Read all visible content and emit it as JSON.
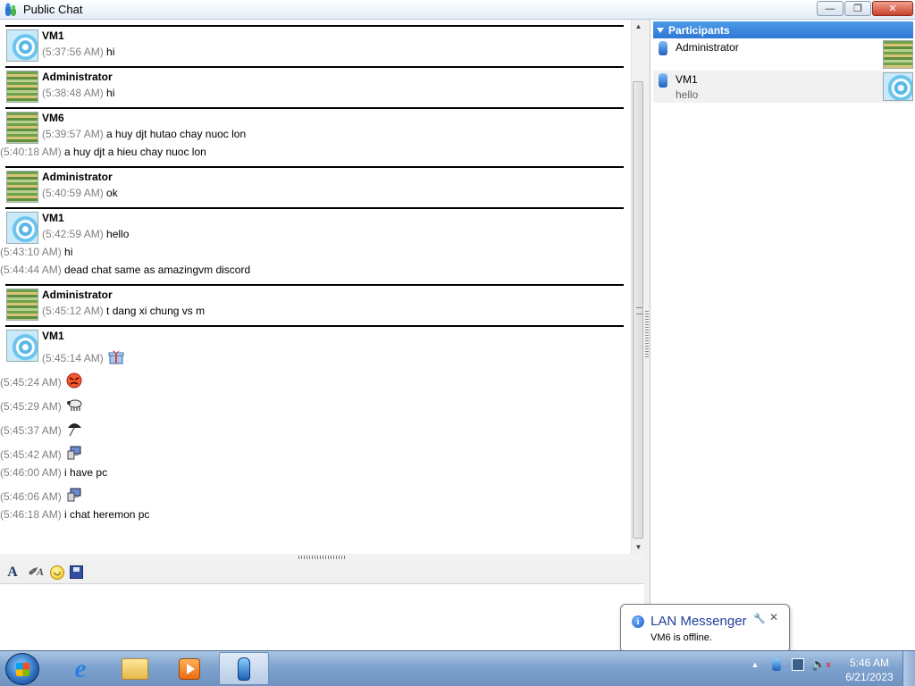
{
  "window": {
    "title": "Public Chat",
    "app_icon": "lan-messenger-icon",
    "buttons": [
      "minimize",
      "maximize",
      "close"
    ]
  },
  "messages": [
    {
      "sender": "VM1",
      "avatar": "vm",
      "lines": [
        {
          "time": "(5:37:56 AM)",
          "text": "hi"
        }
      ]
    },
    {
      "sender": "Administrator",
      "avatar": "admin",
      "lines": [
        {
          "time": "(5:38:48 AM)",
          "text": "hi"
        }
      ]
    },
    {
      "sender": "VM6",
      "avatar": "admin",
      "lines": [
        {
          "time": "(5:39:57 AM)",
          "text": "a huy djt hutao chay nuoc lon"
        },
        {
          "time": "(5:40:18 AM)",
          "text": "a huy djt a hieu chay nuoc lon"
        }
      ]
    },
    {
      "sender": "Administrator",
      "avatar": "admin",
      "lines": [
        {
          "time": "(5:40:59 AM)",
          "text": "ok"
        }
      ]
    },
    {
      "sender": "VM1",
      "avatar": "vm",
      "lines": [
        {
          "time": "(5:42:59 AM)",
          "text": "hello"
        },
        {
          "time": "(5:43:10 AM)",
          "text": "hi"
        },
        {
          "time": "(5:44:44 AM)",
          "text": "dead chat same as amazingvm discord"
        }
      ]
    },
    {
      "sender": "Administrator",
      "avatar": "admin",
      "lines": [
        {
          "time": "(5:45:12 AM)",
          "text": "t dang xi chung vs m"
        }
      ]
    },
    {
      "sender": "VM1",
      "avatar": "vm",
      "lines": [
        {
          "time": "(5:45:14 AM)",
          "emoticon": "gift-icon"
        },
        {
          "time": "(5:45:24 AM)",
          "emoticon": "angry-face-icon"
        },
        {
          "time": "(5:45:29 AM)",
          "emoticon": "sheep-icon"
        },
        {
          "time": "(5:45:37 AM)",
          "emoticon": "umbrella-icon"
        },
        {
          "time": "(5:45:42 AM)",
          "emoticon": "computer-icon"
        },
        {
          "time": "(5:46:00 AM)",
          "text": "i have pc"
        },
        {
          "time": "(5:46:06 AM)",
          "emoticon": "computer-icon"
        },
        {
          "time": "(5:46:18 AM)",
          "text": "i chat heremon pc"
        }
      ]
    }
  ],
  "toolbar": {
    "items": [
      "font-icon",
      "font-style-icon",
      "smiley-icon",
      "save-icon"
    ]
  },
  "input": {
    "value": ""
  },
  "participants": {
    "header": "Participants",
    "items": [
      {
        "name": "Administrator",
        "status": ""
      },
      {
        "name": "VM1",
        "status": "hello"
      }
    ]
  },
  "notification": {
    "title": "LAN Messenger",
    "message": "VM6 is offline."
  },
  "taskbar": {
    "apps": [
      "internet-explorer-icon",
      "file-explorer-icon",
      "media-player-icon",
      "lan-messenger-icon"
    ],
    "clock_time": "5:46 AM",
    "clock_date": "6/21/2023"
  }
}
